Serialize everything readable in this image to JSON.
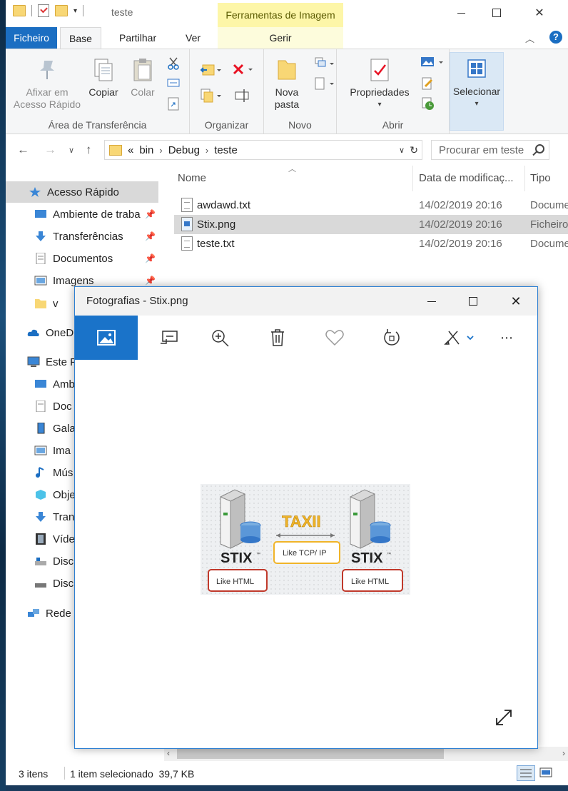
{
  "explorer": {
    "title": "teste",
    "context_tab": "Ferramentas de Imagem",
    "tabs": {
      "file": "Ficheiro",
      "home": "Base",
      "share": "Partilhar",
      "view": "Ver",
      "manage": "Gerir"
    },
    "ribbon": {
      "pin_line1": "Afixar em",
      "pin_line2": "Acesso Rápido",
      "copy": "Copiar",
      "paste": "Colar",
      "clipboard_group": "Área de Transferência",
      "organize_group": "Organizar",
      "new_folder_line1": "Nova",
      "new_folder_line2": "pasta",
      "new_group": "Novo",
      "properties": "Propriedades",
      "open_group": "Abrir",
      "select": "Selecionar"
    },
    "address": {
      "overflow": "«",
      "crumbs": [
        "bin",
        "Debug",
        "teste"
      ]
    },
    "search_placeholder": "Procurar em teste",
    "nav": {
      "quick_access": "Acesso Rápido",
      "desktop": "Ambiente de traba",
      "downloads": "Transferências",
      "documents": "Documentos",
      "images": "Imagens",
      "v": "v",
      "onedrive": "OneD",
      "this_pc": "Este P",
      "pc_desktop": "Amb",
      "pc_docs": "Doc",
      "pc_gallery": "Gala",
      "pc_images": "Ima",
      "pc_music": "Mús",
      "pc_objects": "Obje",
      "pc_downloads": "Tran",
      "pc_video": "Víde",
      "pc_disk1": "Disc",
      "pc_disk2": "Disc",
      "network": "Rede"
    },
    "columns": {
      "name": "Nome",
      "date": "Data de modificaç...",
      "type": "Tipo"
    },
    "files": [
      {
        "name": "awdawd.txt",
        "date": "14/02/2019 20:16",
        "type": "Documento"
      },
      {
        "name": "Stix.png",
        "date": "14/02/2019 20:16",
        "type": "Ficheiro"
      },
      {
        "name": "teste.txt",
        "date": "14/02/2019 20:16",
        "type": "Documento"
      }
    ],
    "status": {
      "count": "3 itens",
      "selection": "1 item selecionado  39,7 KB"
    }
  },
  "photos": {
    "title": "Fotografias - Stix.png",
    "image": {
      "stix": "STIX",
      "stix_mark": "™",
      "taxii": "TAXII",
      "like_html": "Like HTML",
      "like_tcpip": "Like TCP/ IP"
    }
  },
  "colors": {
    "accent": "#1a73c9",
    "ribbon_file": "#1b6ec2",
    "context_tab": "#fdf6a8",
    "selection": "#d9d9d9"
  }
}
